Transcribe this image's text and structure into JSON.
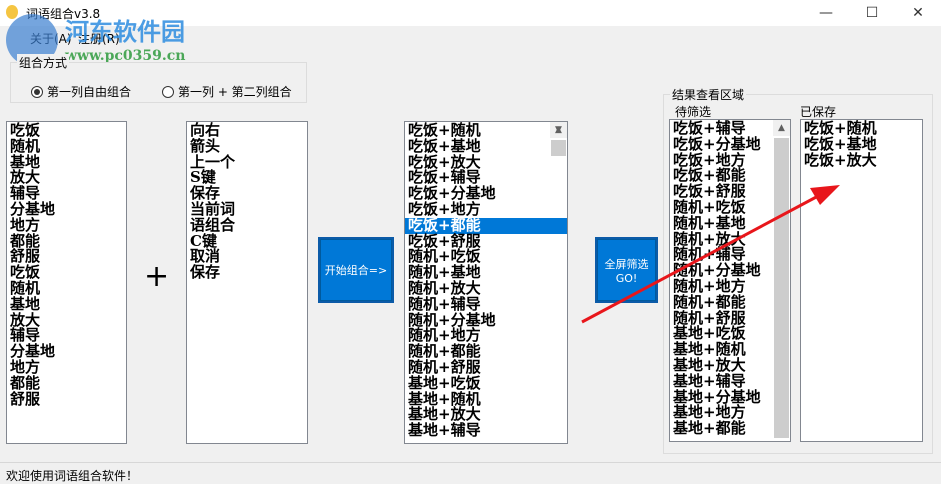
{
  "window": {
    "title": "词语组合v3.8",
    "minimize": "—",
    "maximize": "☐",
    "close": "✕"
  },
  "watermark": {
    "name": "河东软件园",
    "url": "www.pc0359.cn"
  },
  "menu": [
    "关于(A)",
    "注册(R)"
  ],
  "mode": {
    "label": "组合方式",
    "options": [
      {
        "label": "第一列自由组合",
        "checked": true
      },
      {
        "label": "第一列 + 第二列组合",
        "checked": false
      }
    ]
  },
  "list1": [
    "吃饭",
    "随机",
    "基地",
    "放大",
    "辅导",
    "分基地",
    "地方",
    "都能",
    "舒服",
    "吃饭",
    "随机",
    "基地",
    "放大",
    "辅导",
    "分基地",
    "地方",
    "都能",
    "舒服"
  ],
  "plus": "+",
  "list2": [
    "向右",
    "箭头",
    "上一个",
    "S键",
    "保存",
    "当前词",
    "语组合",
    "C键",
    "取消",
    "保存"
  ],
  "combine_button": "开始组合=>",
  "list3": [
    "吃饭+随机",
    "吃饭+基地",
    "吃饭+放大",
    "吃饭+辅导",
    "吃饭+分基地",
    "吃饭+地方",
    "吃饭+都能",
    "吃饭+舒服",
    "随机+吃饭",
    "随机+基地",
    "随机+放大",
    "随机+辅导",
    "随机+分基地",
    "随机+地方",
    "随机+都能",
    "随机+舒服",
    "基地+吃饭",
    "基地+随机",
    "基地+放大",
    "基地+辅导"
  ],
  "list3_selected": 6,
  "filter_button": {
    "line1": "全屏筛选",
    "line2": "GO!"
  },
  "results": {
    "label": "结果查看区域",
    "pending_label": "待筛选",
    "saved_label": "已保存",
    "pending": [
      "吃饭+辅导",
      "吃饭+分基地",
      "吃饭+地方",
      "吃饭+都能",
      "吃饭+舒服",
      "随机+吃饭",
      "随机+基地",
      "随机+放大",
      "随机+辅导",
      "随机+分基地",
      "随机+地方",
      "随机+都能",
      "随机+舒服",
      "基地+吃饭",
      "基地+随机",
      "基地+放大",
      "基地+辅导",
      "基地+分基地",
      "基地+地方",
      "基地+都能"
    ],
    "saved": [
      "吃饭+随机",
      "吃饭+基地",
      "吃饭+放大"
    ]
  },
  "status": "欢迎使用词语组合软件！",
  "colors": {
    "accent": "#0078d7",
    "arrow": "#e8161b"
  }
}
